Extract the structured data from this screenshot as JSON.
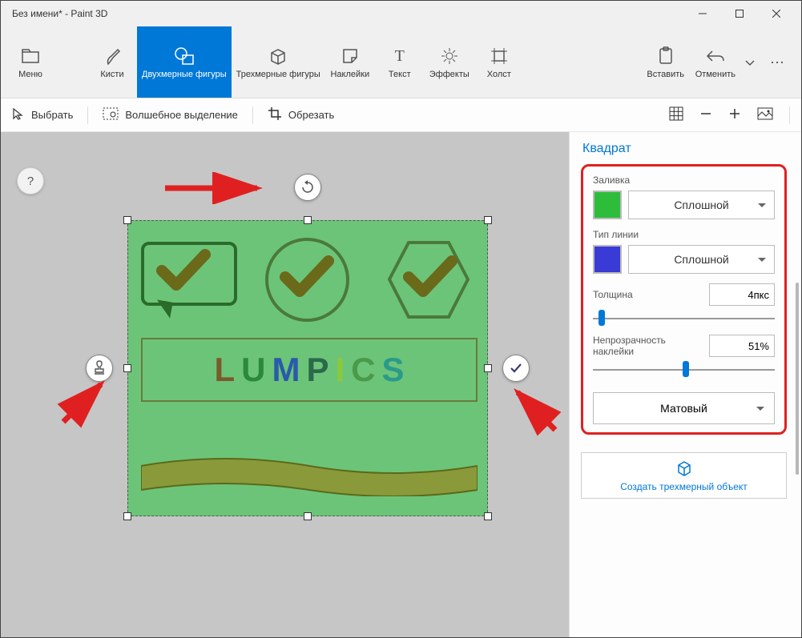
{
  "window": {
    "title": "Без имени* - Paint 3D"
  },
  "ribbon": {
    "menu": "Меню",
    "brushes": "Кисти",
    "shapes2d": "Двухмерные фигуры",
    "shapes3d": "Трехмерные фигуры",
    "stickers": "Наклейки",
    "text": "Текст",
    "effects": "Эффекты",
    "canvas": "Холст",
    "paste": "Вставить",
    "undo": "Отменить"
  },
  "toolbar": {
    "select": "Выбрать",
    "magic": "Волшебное выделение",
    "crop": "Обрезать"
  },
  "canvas": {
    "text": "LUMPICS",
    "letters": [
      {
        "ch": "L",
        "color": "#7a5a2a"
      },
      {
        "ch": "U",
        "color": "#2a8a3a"
      },
      {
        "ch": "M",
        "color": "#2a5aaa"
      },
      {
        "ch": "P",
        "color": "#2a6a4a"
      },
      {
        "ch": "I",
        "color": "#8aca3a"
      },
      {
        "ch": "C",
        "color": "#4a9a4a"
      },
      {
        "ch": "S",
        "color": "#2a9a8a"
      }
    ],
    "help": "?"
  },
  "side": {
    "title": "Квадрат",
    "fill_label": "Заливка",
    "fill_color": "#2dbd3a",
    "fill_mode": "Сплошной",
    "line_label": "Тип линии",
    "line_color": "#3a3ad6",
    "line_mode": "Сплошной",
    "thickness_label": "Толщина",
    "thickness_value": "4пкс",
    "thickness_pct": 5,
    "opacity_label": "Непрозрачность наклейки",
    "opacity_value": "51%",
    "opacity_pct": 51,
    "material": "Матовый",
    "make3d": "Создать трехмерный объект"
  }
}
